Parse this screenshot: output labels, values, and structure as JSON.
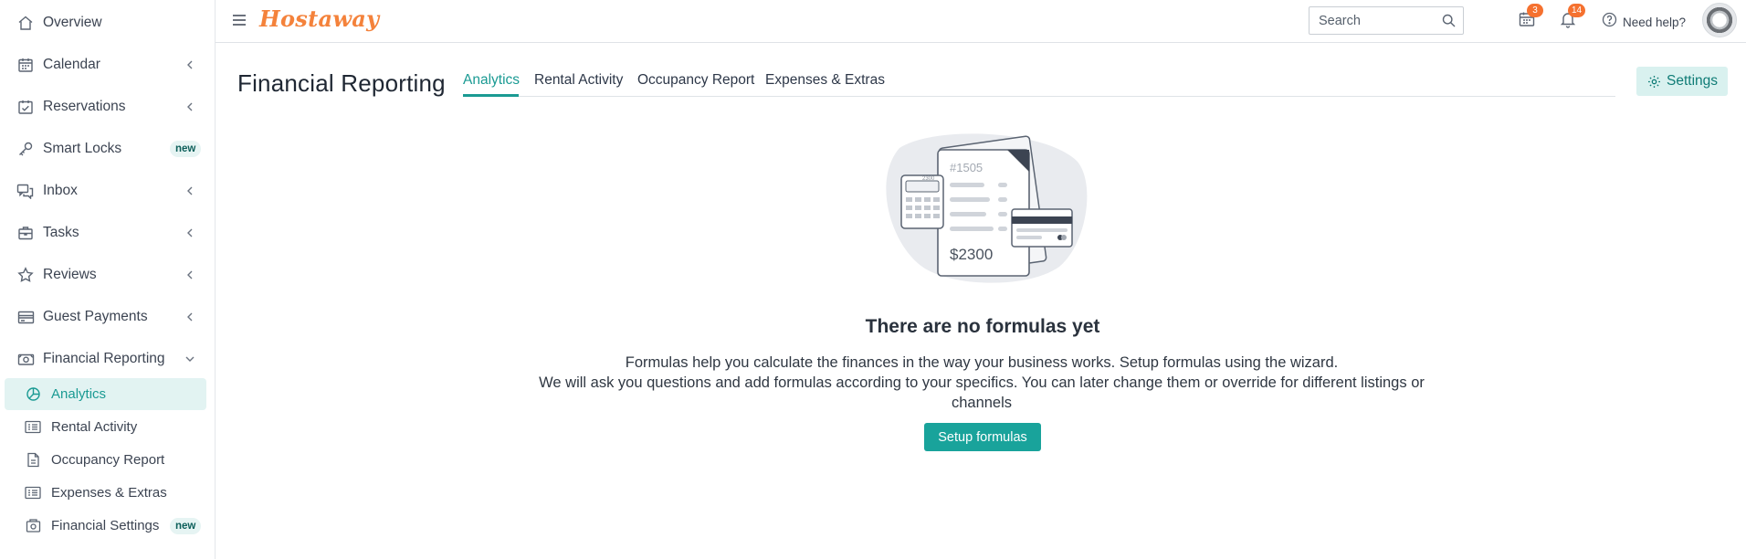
{
  "app": {
    "logo_text": "Hostaway",
    "brand_color": "#f4823b",
    "accent_color": "#1a9a93"
  },
  "sidebar": {
    "items": [
      {
        "label": "Overview",
        "icon": "home-icon",
        "has_chevron": false
      },
      {
        "label": "Calendar",
        "icon": "calendar-icon",
        "has_chevron": true
      },
      {
        "label": "Reservations",
        "icon": "calendar-check-icon",
        "has_chevron": true
      },
      {
        "label": "Smart Locks",
        "icon": "key-icon",
        "badge": "new"
      },
      {
        "label": "Inbox",
        "icon": "chat-icon",
        "has_chevron": true
      },
      {
        "label": "Tasks",
        "icon": "briefcase-icon",
        "has_chevron": true
      },
      {
        "label": "Reviews",
        "icon": "star-icon",
        "has_chevron": true
      },
      {
        "label": "Guest Payments",
        "icon": "credit-card-icon",
        "has_chevron": true
      },
      {
        "label": "Financial Reporting",
        "icon": "money-icon",
        "expanded": true
      }
    ],
    "subitems": [
      {
        "label": "Analytics",
        "icon": "pie-chart-icon",
        "active": true
      },
      {
        "label": "Rental Activity",
        "icon": "list-card-icon"
      },
      {
        "label": "Occupancy Report",
        "icon": "document-icon"
      },
      {
        "label": "Expenses & Extras",
        "icon": "list-card-icon"
      },
      {
        "label": "Financial Settings",
        "icon": "money-settings-icon",
        "badge": "new"
      }
    ]
  },
  "topbar": {
    "search_placeholder": "Search",
    "calendar_badge": "3",
    "bell_badge": "14",
    "help_label": "Need help?"
  },
  "page": {
    "title": "Financial Reporting",
    "tabs": [
      {
        "label": "Analytics",
        "active": true
      },
      {
        "label": "Rental Activity"
      },
      {
        "label": "Occupancy Report"
      },
      {
        "label": "Expenses & Extras"
      }
    ],
    "settings_label": "Settings"
  },
  "empty_state": {
    "illustration": {
      "invoice_number": "#1505",
      "amount": "$2300",
      "calc_display": "2300"
    },
    "title": "There are no formulas yet",
    "desc_line1": "Formulas help you calculate the finances in the way your business works. Setup formulas using the wizard.",
    "desc_line2": "We will ask you questions and add formulas according to your specifics. You can later change them or override for different listings or channels",
    "button_label": "Setup formulas"
  }
}
